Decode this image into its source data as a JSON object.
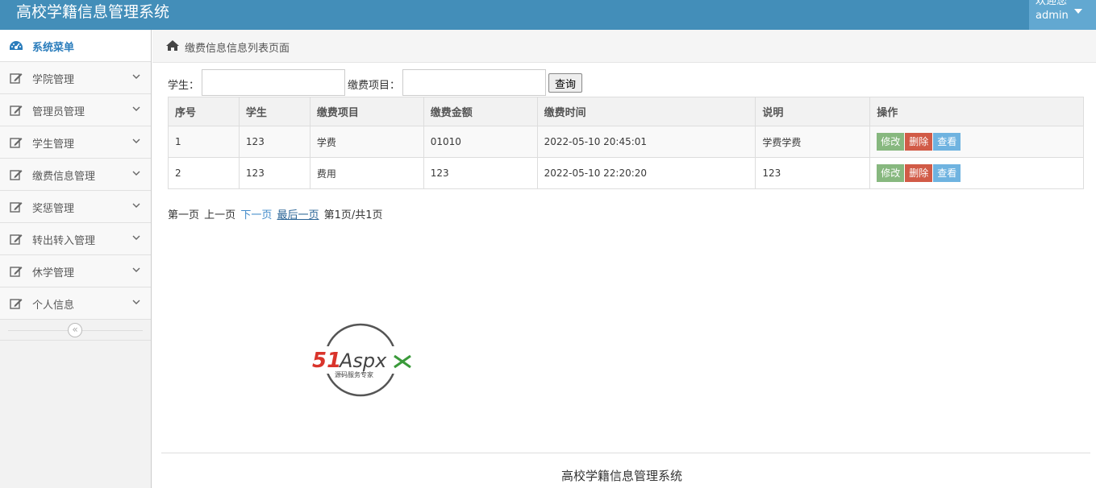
{
  "header": {
    "app_title": "高校学籍信息管理系统",
    "welcome": "欢迎您",
    "username": "admin"
  },
  "sidebar": {
    "title": "系统菜单",
    "items": [
      {
        "label": "学院管理"
      },
      {
        "label": "管理员管理"
      },
      {
        "label": "学生管理"
      },
      {
        "label": "缴费信息管理"
      },
      {
        "label": "奖惩管理"
      },
      {
        "label": "转出转入管理"
      },
      {
        "label": "休学管理"
      },
      {
        "label": "个人信息"
      }
    ],
    "collapse_glyph": "«"
  },
  "breadcrumb": {
    "text": "缴费信息信息列表页面"
  },
  "search": {
    "student_label": "学生：",
    "student_value": "",
    "item_label": "缴费项目：",
    "item_value": "",
    "button_label": "查询"
  },
  "table": {
    "headers": [
      "序号",
      "学生",
      "缴费项目",
      "缴费金额",
      "缴费时间",
      "说明",
      "操作"
    ],
    "rows": [
      {
        "index": "1",
        "student": "123",
        "item": "学费",
        "amount": "01010",
        "time": "2022-05-10 20:45:01",
        "note": "学费学费"
      },
      {
        "index": "2",
        "student": "123",
        "item": "费用",
        "amount": "123",
        "time": "2022-05-10 22:20:20",
        "note": "123"
      }
    ],
    "actions": {
      "edit": "修改",
      "delete": "删除",
      "view": "查看"
    }
  },
  "pager": {
    "first": "第一页",
    "prev": "上一页",
    "next": "下一页",
    "last": "最后一页",
    "status": "第1页/共1页"
  },
  "logo": {
    "brand_red": "51",
    "brand_dark": "Aspx",
    "tagline": "源码服务专家"
  },
  "footer": {
    "text": "高校学籍信息管理系统"
  },
  "colors": {
    "header_bg": "#438eb9",
    "accent": "#2b7dbc",
    "edit": "#87b87f",
    "delete": "#d15b47",
    "view": "#6fb3e0"
  }
}
